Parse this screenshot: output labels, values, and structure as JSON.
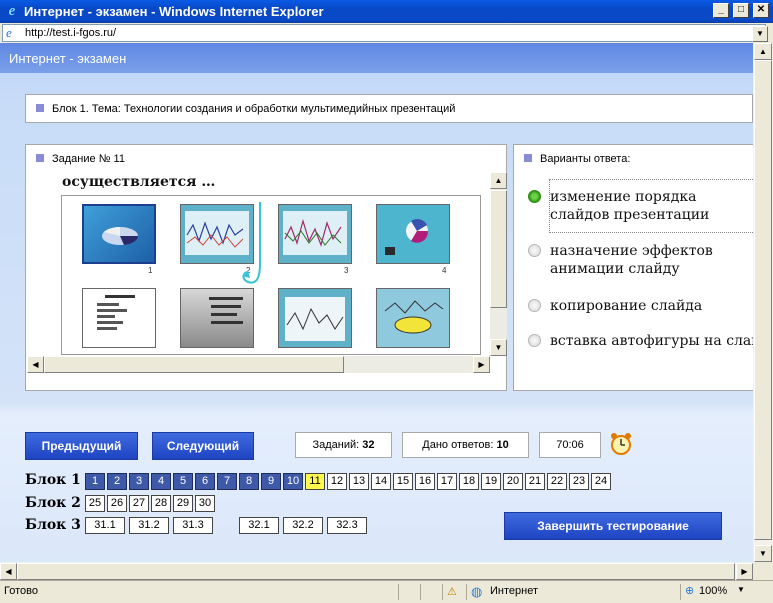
{
  "window": {
    "title": "Интернет - экзамен - Windows Internet Explorer"
  },
  "address": {
    "url": "http://test.i-fgos.ru/"
  },
  "app": {
    "header": "Интернет - экзамен"
  },
  "block": {
    "title": "Блок 1. Тема: Технологии создания и обработки мультимедийных презентаций"
  },
  "task": {
    "label": "Задание № 11",
    "question_fragment": "осуществляется …"
  },
  "answers": {
    "label": "Варианты ответа:",
    "options": [
      {
        "text": "изменение порядка слайдов презентации",
        "selected": true
      },
      {
        "text": "назначение эффектов анимации слайду",
        "selected": false
      },
      {
        "text": "копирование слайда",
        "selected": false
      },
      {
        "text": "вставка автофигуры на слайд",
        "selected": false
      }
    ]
  },
  "nav": {
    "prev": "Предыдущий",
    "next": "Следующий",
    "finish": "Завершить тестирование"
  },
  "stats": {
    "tasks_label": "Заданий:",
    "tasks": "32",
    "answered_label": "Дано ответов:",
    "answered": "10",
    "timer": "70:06"
  },
  "blocks": [
    {
      "label": "Блок 1",
      "items": [
        "1",
        "2",
        "3",
        "4",
        "5",
        "6",
        "7",
        "8",
        "9",
        "10",
        "11",
        "12",
        "13",
        "14",
        "15",
        "16",
        "17",
        "18",
        "19",
        "20",
        "21",
        "22",
        "23",
        "24"
      ],
      "done": 10,
      "current": "11"
    },
    {
      "label": "Блок 2",
      "items": [
        "25",
        "26",
        "27",
        "28",
        "29",
        "30"
      ]
    },
    {
      "label": "Блок 3",
      "items": [
        "31.1",
        "31.2",
        "31.3",
        "32.1",
        "32.2",
        "32.3"
      ]
    }
  ],
  "slides": [
    "1",
    "2",
    "3",
    "4"
  ],
  "statusbar": {
    "left": "Готово",
    "zone": "Интернет",
    "zoom": "100%"
  },
  "colors": {
    "header": "#6e94e8",
    "answered": "#3d59a8",
    "current": "#fff94d",
    "button": "#2a55d4"
  }
}
